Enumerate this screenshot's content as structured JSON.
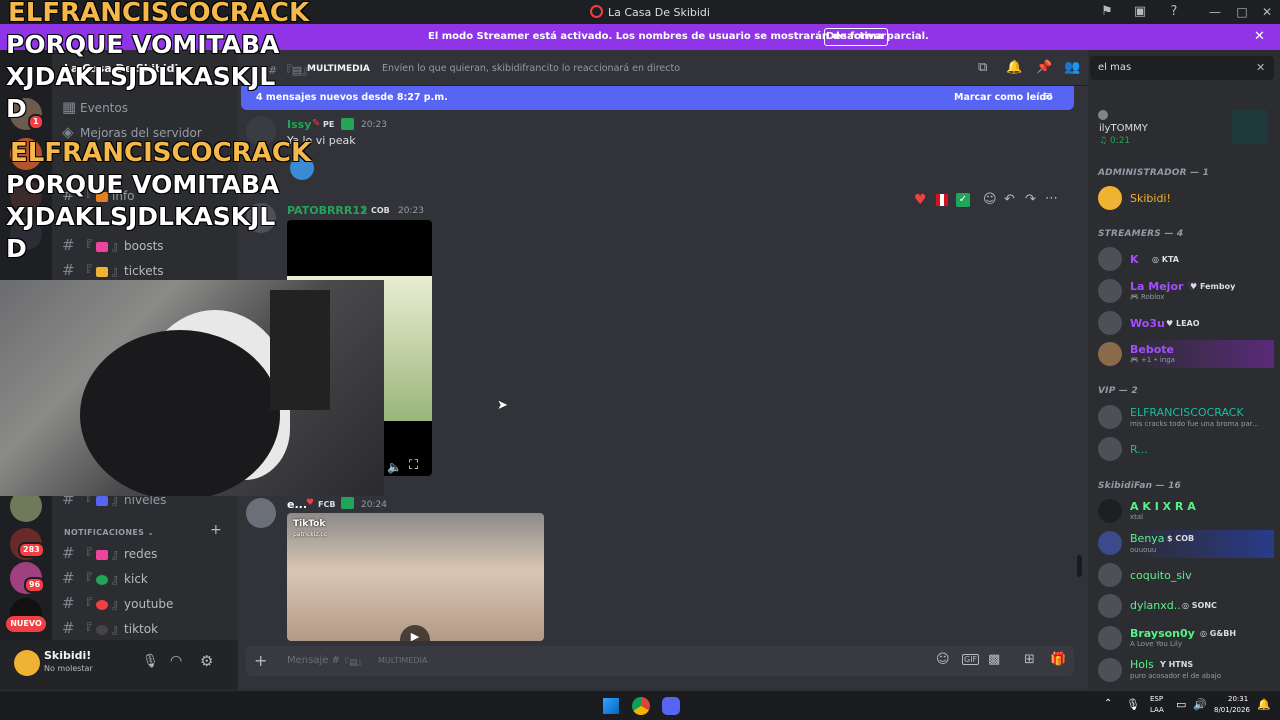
{
  "window": {
    "title": "La Casa De Skibidi"
  },
  "banner": {
    "message": "El modo Streamer está activado. Los nombres de usuario se mostrarán de forma parcial.",
    "button": "Desactivar"
  },
  "server": {
    "name": "La Casa De Skibidi",
    "events": "Eventos",
    "boosts_label": "Mejoras del servidor"
  },
  "servers": {
    "badge1": "1",
    "badge2": "283",
    "badge3": "96",
    "new_label": "NUEVO"
  },
  "channels": {
    "info": "info",
    "boosts": "boosts",
    "tickets": "tickets",
    "niveles": "niveles",
    "notif_category": "NOTIFICACIONES",
    "redes": "redes",
    "kick": "kick",
    "youtube": "youtube",
    "tiktok": "tiktok"
  },
  "user": {
    "name": "Skibidi!",
    "status": "No molestar"
  },
  "chat": {
    "channel_name": "MULTIMEDIA",
    "topic": "Envíen lo que quieran, skibidifrancito lo reaccionará en directo",
    "new_messages": "4 mensajes nuevos desde 8:27 p.m.",
    "mark_read": "Marcar como leído",
    "input_placeholder": "Mensaje #",
    "input_channel": "MULTIMEDIA"
  },
  "messages": [
    {
      "author": "Issy",
      "tag": "PE",
      "time": "20:23",
      "text": "Ya lo vi peak",
      "color": "#23a559"
    },
    {
      "author": "PATOBRRR12",
      "tag": "COB",
      "time": "20:23",
      "color": "#23a559"
    },
    {
      "author": "e...",
      "tag": "FCB",
      "time": "20:24",
      "color": "#ffffff",
      "tiktok_label": "TikTok",
      "tiktok_user": "patrickiz.cc"
    }
  ],
  "search": {
    "value": "el mas"
  },
  "members": {
    "top": {
      "name": "ilyTOMMY",
      "time": "0:21"
    },
    "admin_header": "ADMINISTRADOR — 1",
    "admin": [
      {
        "name": "Skibidi!",
        "color": "#f0b232"
      }
    ],
    "streamers_header": "STREAMERS — 4",
    "streamers": [
      {
        "name": "K",
        "tag": "KTA",
        "sub": ""
      },
      {
        "name": "La Mejor ♡",
        "tag": "Femboy",
        "sub": "Roblox"
      },
      {
        "name": "Wo3u",
        "tag": "LEAO",
        "sub": ""
      },
      {
        "name": "Bebote",
        "tag": "",
        "sub": "+1 • inga"
      }
    ],
    "vip_header": "VIP — 2",
    "vip": [
      {
        "name": "ELFRANCISCOCRACK",
        "sub": "mis cracks todo fue una broma par..."
      },
      {
        "name": "R...",
        "sub": ""
      }
    ],
    "fan_header": "SkibidiFan — 16",
    "fans": [
      {
        "name": "A K I X R A",
        "tag": "",
        "sub": "xtal",
        "color": "#57f287"
      },
      {
        "name": "Benya",
        "tag": "COB",
        "sub": "ouuouu",
        "color": "#57f287"
      },
      {
        "name": "coquito_siv",
        "tag": "",
        "sub": "",
        "color": "#57f287"
      },
      {
        "name": "dylanxd..",
        "tag": "SONC",
        "sub": "",
        "color": "#57f287"
      },
      {
        "name": "Brayson0y",
        "tag": "G&BH",
        "sub": "A Love You Lily",
        "color": "#57f287"
      },
      {
        "name": "Hols",
        "tag": "HTNS",
        "sub": "puro acosador el de abajo",
        "color": "#57f287"
      }
    ]
  },
  "overlay": {
    "line1": "ELFRANCISCOCRACK",
    "line2": "PORQUE VOMITABA",
    "line3": "XJDAKLSJDLKASKJL",
    "line4": "D",
    "line5": "ELFRANCISCOCRACK",
    "line6": "PORQUE VOMITABA",
    "line7": "XJDAKLSJDLKASKJL",
    "line8": "D"
  },
  "taskbar": {
    "lang": "ESP",
    "lang2": "LAA",
    "time": "20:31",
    "date": "8/01/2026"
  }
}
